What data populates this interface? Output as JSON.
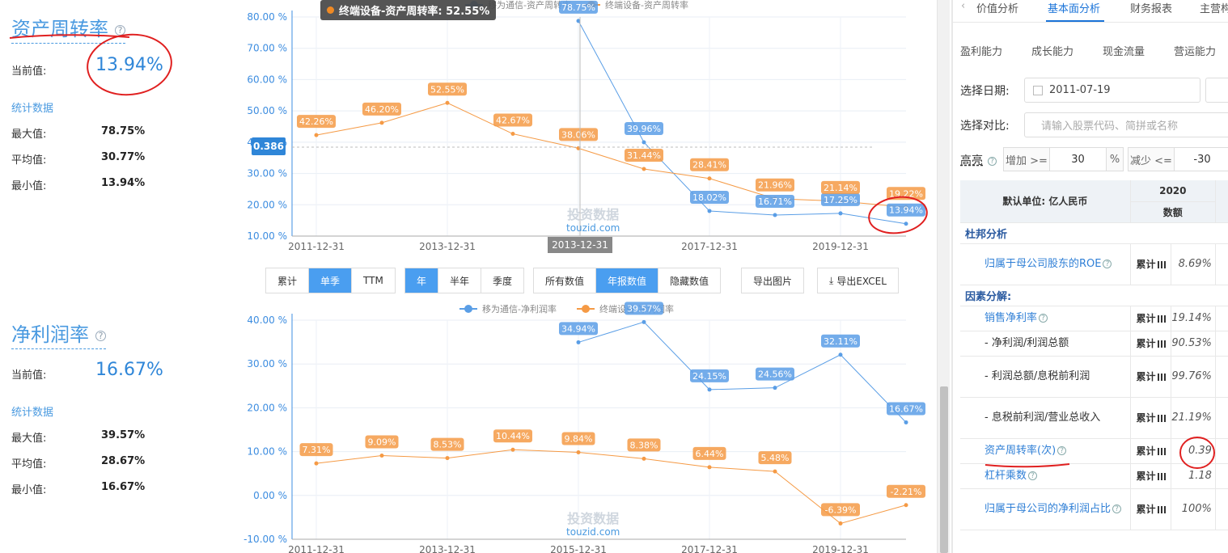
{
  "asset_turnover": {
    "title": "资产周转率",
    "help_icon": "question-circle-icon",
    "current_label": "当前值:",
    "current_value": "13.94%",
    "stats_label": "统计数据",
    "max_label": "最大值:",
    "max_value": "78.75%",
    "avg_label": "平均值:",
    "avg_value": "30.77%",
    "min_label": "最小值:",
    "min_value": "13.94%"
  },
  "net_margin": {
    "title": "净利润率",
    "help_icon": "question-circle-icon",
    "current_label": "当前值:",
    "current_value": "16.67%",
    "stats_label": "统计数据",
    "max_label": "最大值:",
    "max_value": "39.57%",
    "avg_label": "平均值:",
    "avg_value": "28.67%",
    "min_label": "最小值:",
    "min_value": "16.67%"
  },
  "tooltip": {
    "text": "终端设备-资产周转率: 52.55%"
  },
  "crosshair": {
    "x_label": "2013-12-31",
    "y_label": "0.386"
  },
  "watermark": {
    "cn": "投资数据",
    "en": "touzid.com"
  },
  "toolbar": {
    "group1": [
      "累计",
      "单季",
      "TTM"
    ],
    "group2": [
      "年",
      "半年",
      "季度"
    ],
    "group3": [
      "所有数值",
      "年报数值",
      "隐藏数值"
    ],
    "export_image": "导出图片",
    "export_excel": "导出EXCEL",
    "download_icon": "download-icon"
  },
  "chart_data": [
    {
      "type": "line",
      "ylim": [
        10,
        80
      ],
      "yticks": [
        "80.00 %",
        "70.00 %",
        "60.00 %",
        "50.00 %",
        "40.00 %",
        "30.00 %",
        "20.00 %",
        "10.00 %"
      ],
      "xticks": [
        "2011-12-31",
        "2013-12-31",
        "2015-12-31",
        "2017-12-31",
        "2019-12-31"
      ],
      "x": [
        "2011-12-31",
        "2012-12-31",
        "2013-12-31",
        "2014-12-31",
        "2015-12-31",
        "2016-12-31",
        "2017-12-31",
        "2018-12-31",
        "2019-12-31",
        "2020-12-31"
      ],
      "legend_position": "top",
      "series": [
        {
          "name": "移为通信-资产周转率",
          "color": "#5a9ee6",
          "values": [
            null,
            null,
            null,
            null,
            78.75,
            39.96,
            18.02,
            16.71,
            17.25,
            13.94
          ],
          "labels": [
            null,
            null,
            null,
            null,
            "78.75%",
            "39.96%",
            "18.02%",
            "16.71%",
            "17.25%",
            "13.94%"
          ]
        },
        {
          "name": "终端设备-资产周转率",
          "color": "#f59a45",
          "values": [
            42.26,
            46.2,
            52.55,
            42.67,
            38.06,
            31.44,
            28.41,
            21.96,
            21.14,
            19.22
          ],
          "labels": [
            "42.26%",
            "46.20%",
            "52.55%",
            "42.67%",
            "38.06%",
            "31.44%",
            "28.41%",
            "21.96%",
            "21.14%",
            "19.22%"
          ]
        }
      ]
    },
    {
      "type": "line",
      "ylim": [
        -10,
        40
      ],
      "yticks": [
        "40.00 %",
        "30.00 %",
        "20.00 %",
        "10.00 %",
        "0.00 %",
        "-10.00 %"
      ],
      "xticks": [
        "2011-12-31",
        "2013-12-31",
        "2015-12-31",
        "2017-12-31",
        "2019-12-31"
      ],
      "x": [
        "2011-12-31",
        "2012-12-31",
        "2013-12-31",
        "2014-12-31",
        "2015-12-31",
        "2016-12-31",
        "2017-12-31",
        "2018-12-31",
        "2019-12-31",
        "2020-12-31"
      ],
      "legend_position": "top",
      "series": [
        {
          "name": "移为通信-净利润率",
          "color": "#5a9ee6",
          "values": [
            null,
            null,
            null,
            null,
            34.94,
            39.57,
            24.15,
            24.56,
            32.11,
            16.67
          ],
          "labels": [
            null,
            null,
            null,
            null,
            "34.94%",
            "39.57%",
            "24.15%",
            "24.56%",
            "32.11%",
            "16.67%"
          ]
        },
        {
          "name": "终端设备-净利润率",
          "color": "#f59a45",
          "values": [
            7.31,
            9.09,
            8.53,
            10.44,
            9.84,
            8.38,
            6.44,
            5.48,
            -6.39,
            -2.21
          ],
          "labels": [
            "7.31%",
            "9.09%",
            "8.53%",
            "10.44%",
            "9.84%",
            "8.38%",
            "6.44%",
            "5.48%",
            "-6.39%",
            "-2.21%"
          ]
        }
      ]
    }
  ],
  "right_panel": {
    "back_icon": "chevron-left-icon",
    "tabs": [
      "价值分析",
      "基本面分析",
      "财务报表",
      "主营构成"
    ],
    "active_tab": 1,
    "subtabs": [
      "盈利能力",
      "成长能力",
      "现金流量",
      "营运能力"
    ],
    "date_label": "选择日期:",
    "date_value": "2011-07-19",
    "calendar_icon": "calendar-icon",
    "compare_label": "选择对比:",
    "compare_placeholder": "请输入股票代码、简拼或名称",
    "highlight_label": "高亮",
    "increase_label": "增加 >=",
    "increase_value": "30",
    "percent": "%",
    "decrease_label": "减少 <=",
    "decrease_value": "-30",
    "table": {
      "unit_header": "默认单位: 亿人民币",
      "year_header": "2020",
      "amount_header": "数额",
      "sections": [
        {
          "title": "杜邦分析",
          "rows": [
            {
              "name": "归属于母公司股东的ROE",
              "type": "累计",
              "value": "8.69%"
            }
          ]
        },
        {
          "title": "因素分解:",
          "rows": [
            {
              "name": "销售净利率",
              "type": "累计",
              "value": "19.14%"
            },
            {
              "name": "- 净利润/利润总额",
              "type": "累计",
              "value": "90.53%"
            },
            {
              "name": "- 利润总额/息税前利润",
              "type": "累计",
              "value": "99.76%"
            },
            {
              "name": "- 息税前利润/营业总收入",
              "type": "累计",
              "value": "21.19%"
            },
            {
              "name": "资产周转率(次)",
              "type": "累计",
              "value": "0.39"
            },
            {
              "name": "杠杆乘数",
              "type": "累计",
              "value": "1.18"
            },
            {
              "name": "归属于母公司的净利润占比",
              "type": "累计",
              "value": "100%"
            }
          ]
        }
      ]
    }
  }
}
